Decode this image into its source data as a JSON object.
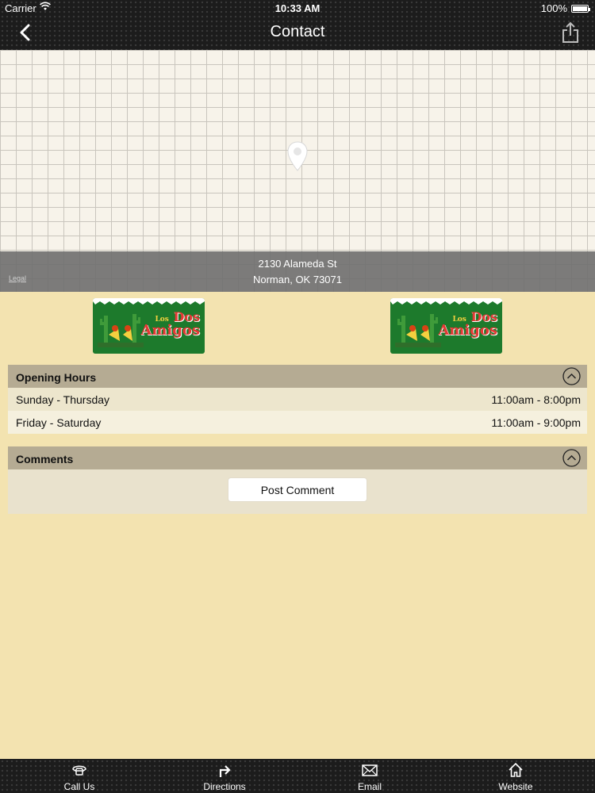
{
  "status_bar": {
    "carrier": "Carrier",
    "time": "10:33 AM",
    "battery": "100%"
  },
  "nav": {
    "title": "Contact",
    "back_icon": "chevron-left-icon",
    "share_icon": "share-icon"
  },
  "map": {
    "address_line1": "2130 Alameda St",
    "address_line2": "Norman, OK 73071",
    "legal": "Legal",
    "pin_icon": "map-pin-icon"
  },
  "logo": {
    "los": "Los",
    "dos": "Dos",
    "amigos": "Amigos"
  },
  "opening_hours": {
    "title": "Opening Hours",
    "rows": [
      {
        "day": "Sunday - Thursday",
        "hours": "11:00am - 8:00pm"
      },
      {
        "day": "Friday - Saturday",
        "hours": "11:00am - 9:00pm"
      }
    ]
  },
  "comments": {
    "title": "Comments",
    "post_button": "Post Comment"
  },
  "tabs": [
    {
      "label": "Call Us",
      "icon": "phone-icon"
    },
    {
      "label": "Directions",
      "icon": "directions-arrow-icon"
    },
    {
      "label": "Email",
      "icon": "envelope-icon"
    },
    {
      "label": "Website",
      "icon": "home-icon"
    }
  ],
  "colors": {
    "background": "#f3e3b0",
    "bar": "#1c1c1c",
    "section_header": "#b5ab93",
    "logo_green": "#1d7a2c",
    "logo_red": "#e53935"
  }
}
